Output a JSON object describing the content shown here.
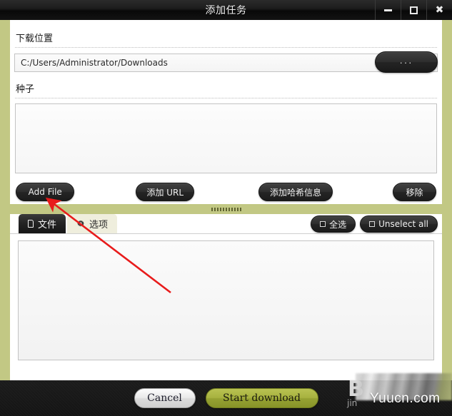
{
  "window": {
    "title": "添加任务",
    "controls": [
      {
        "name": "minimize",
        "glyph": "minimize-icon"
      },
      {
        "name": "maximize",
        "glyph": "maximize-icon"
      },
      {
        "name": "close",
        "glyph": "close-icon",
        "label": "✖"
      }
    ]
  },
  "download_location": {
    "label": "下载位置",
    "path_value": "C:/Users/Administrator/Downloads",
    "path_placeholder": "C:/Users/Administrator/Downloads",
    "browse_label": "···"
  },
  "seeds": {
    "label": "种子",
    "list_value": "",
    "buttons": {
      "add_file": "Add File",
      "add_url": "添加 URL",
      "add_hash": "添加哈希信息",
      "remove": "移除"
    }
  },
  "tabs": [
    {
      "label": "文件",
      "icon": "document-icon",
      "active": true
    },
    {
      "label": "选项",
      "icon": "gear-icon",
      "active": false
    }
  ],
  "tab_actions": {
    "select_all": "全选",
    "unselect_all": "Unselect all"
  },
  "file_list": {
    "items": []
  },
  "footer": {
    "cancel_label": "Cancel",
    "start_label": "Start download"
  },
  "watermark": {
    "letter": "B",
    "subtext": "jin",
    "site": "Yuucn.com"
  },
  "colors": {
    "frame_olive": "#c2c884",
    "titlebar_dark": "#1a1a1a",
    "accent_green": "#a7b23f",
    "annotation_red": "#e81b1b"
  }
}
